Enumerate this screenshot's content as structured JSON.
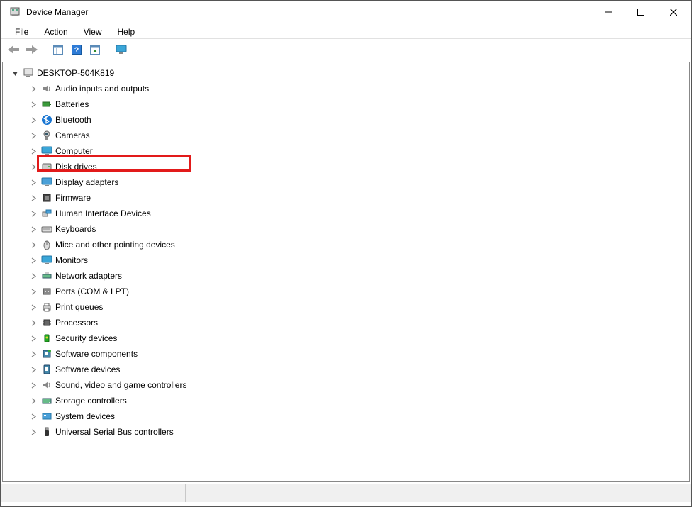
{
  "window": {
    "title": "Device Manager"
  },
  "menu": {
    "file": "File",
    "action": "Action",
    "view": "View",
    "help": "Help"
  },
  "tree": {
    "root": "DESKTOP-504K819",
    "items": [
      {
        "label": "Audio inputs and outputs",
        "icon": "speaker"
      },
      {
        "label": "Batteries",
        "icon": "battery"
      },
      {
        "label": "Bluetooth",
        "icon": "bluetooth"
      },
      {
        "label": "Cameras",
        "icon": "camera"
      },
      {
        "label": "Computer",
        "icon": "computer"
      },
      {
        "label": "Disk drives",
        "icon": "disk"
      },
      {
        "label": "Display adapters",
        "icon": "display"
      },
      {
        "label": "Firmware",
        "icon": "firmware"
      },
      {
        "label": "Human Interface Devices",
        "icon": "hid"
      },
      {
        "label": "Keyboards",
        "icon": "keyboard"
      },
      {
        "label": "Mice and other pointing devices",
        "icon": "mouse"
      },
      {
        "label": "Monitors",
        "icon": "monitor"
      },
      {
        "label": "Network adapters",
        "icon": "network"
      },
      {
        "label": "Ports (COM & LPT)",
        "icon": "port"
      },
      {
        "label": "Print queues",
        "icon": "printer"
      },
      {
        "label": "Processors",
        "icon": "cpu"
      },
      {
        "label": "Security devices",
        "icon": "security"
      },
      {
        "label": "Software components",
        "icon": "swcomp"
      },
      {
        "label": "Software devices",
        "icon": "swdev"
      },
      {
        "label": "Sound, video and game controllers",
        "icon": "sound"
      },
      {
        "label": "Storage controllers",
        "icon": "storage"
      },
      {
        "label": "System devices",
        "icon": "system"
      },
      {
        "label": "Universal Serial Bus controllers",
        "icon": "usb"
      }
    ]
  },
  "highlighted_index": 0
}
